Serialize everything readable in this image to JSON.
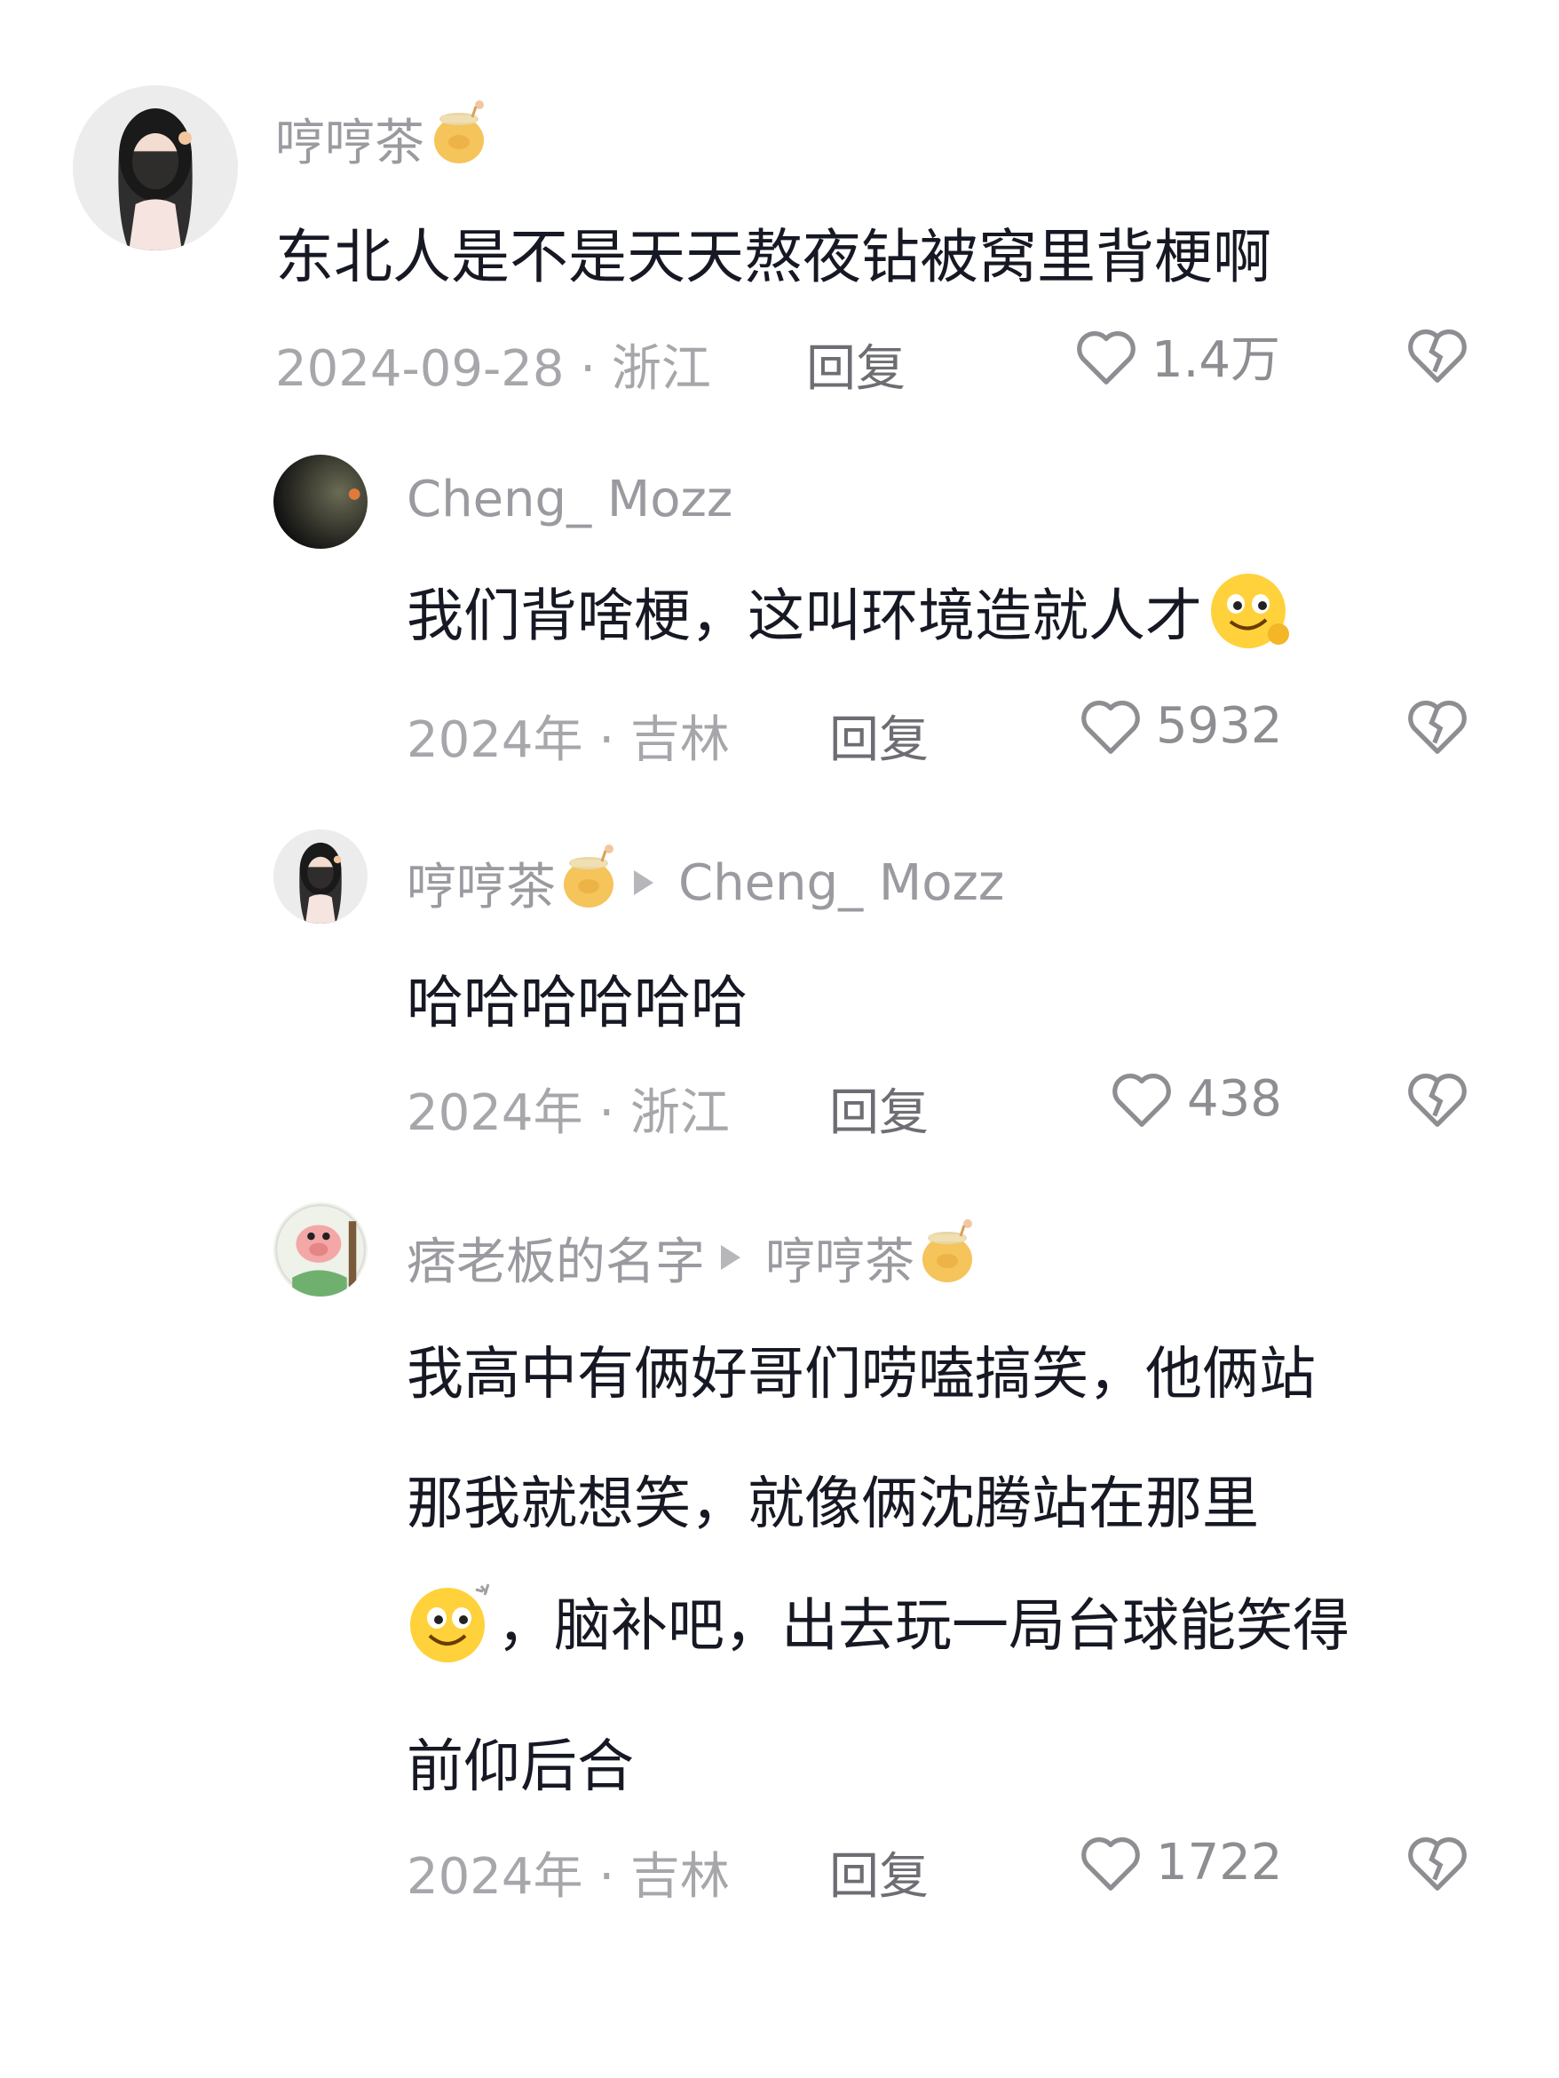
{
  "comments": [
    {
      "author": "哼哼茶",
      "content": "东北人是不是天天熬夜钻被窝里背梗啊",
      "meta": "2024-09-28 · 浙江",
      "reply_label": "回复",
      "likes": "1.4万"
    },
    {
      "author": "Cheng_ Mozz",
      "content": "我们背啥梗，这叫环境造就人才",
      "meta": "2024年 · 吉林",
      "reply_label": "回复",
      "likes": "5932"
    },
    {
      "author": "哼哼茶",
      "reply_to": "Cheng_ Mozz",
      "content": "哈哈哈哈哈哈",
      "meta": "2024年 · 浙江",
      "reply_label": "回复",
      "likes": "438"
    },
    {
      "author": "痞老板的名字",
      "reply_to": "哼哼茶",
      "content_lines": [
        "我高中有俩好哥们唠嗑搞笑，他俩站",
        "那我就想笑，就像俩沈腾站在那里",
        "，脑补吧，出去玩一局台球能笑得",
        "前仰后合"
      ],
      "meta": "2024年 · 吉林",
      "reply_label": "回复",
      "likes": "1722"
    }
  ],
  "icons": {
    "like": "heart-outline-icon",
    "dislike": "broken-heart-icon",
    "badge": "honey-jar-badge-icon",
    "reply_arrow": "reply-triangle-icon",
    "emoji1": "smirk-ok-emoji-icon",
    "emoji2": "dizzy-smile-emoji-icon"
  },
  "colors": {
    "text_primary": "#161823",
    "text_secondary": "#9a9aa0",
    "meta": "#a6a6ab",
    "background": "#ffffff"
  }
}
